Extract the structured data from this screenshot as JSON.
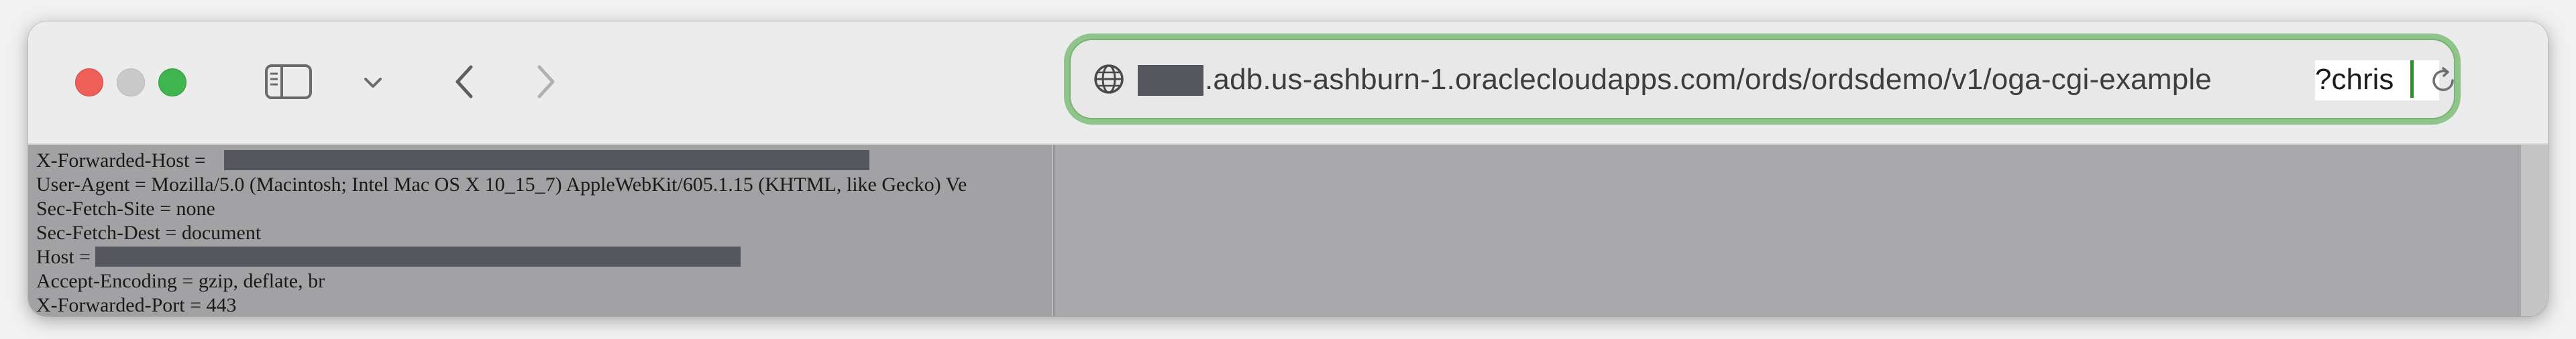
{
  "toolbar": {
    "sidebar_icon": "sidebar-icon",
    "chevron_icon": "chevron-down-icon",
    "back_icon": "chevron-left-icon",
    "forward_icon": "chevron-right-icon"
  },
  "address_bar": {
    "globe_icon": "globe-icon",
    "url_visible": ".adb.us-ashburn-1.oraclecloudapps.com/ords/ordsdemo/v1/oga-cgi-example",
    "url_typed": "?chris",
    "reload_icon": "reload-icon",
    "focus_color": "#8fc48a"
  },
  "headers": [
    {
      "label": "X-Forwarded-Host ="
    },
    {
      "label": "User-Agent = Mozilla/5.0 (Macintosh; Intel Mac OS X 10_15_7) AppleWebKit/605.1.15 (KHTML, like Gecko) Ve"
    },
    {
      "label": "Sec-Fetch-Site = none"
    },
    {
      "label": "Sec-Fetch-Dest = document"
    },
    {
      "label": "Host ="
    },
    {
      "label": "Accept-Encoding = gzip, deflate, br"
    },
    {
      "label": "X-Forwarded-Port = 443"
    }
  ]
}
